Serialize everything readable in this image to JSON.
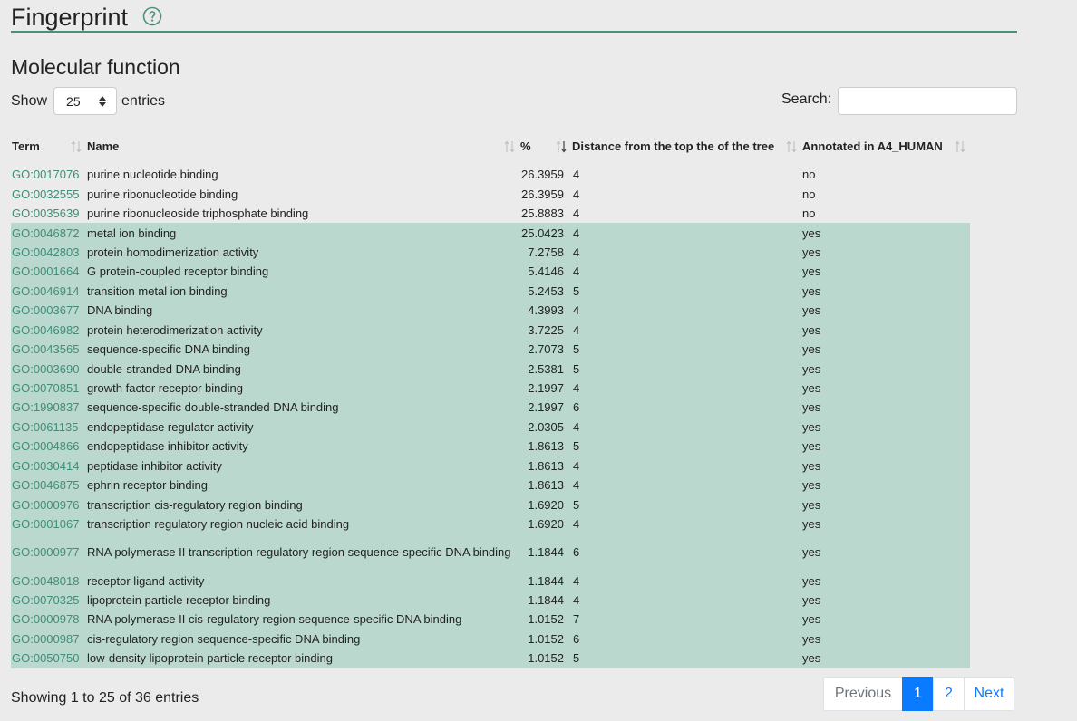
{
  "header": {
    "title": "Fingerprint",
    "help_icon": "question-circle-icon",
    "accent": "#4d8f7c"
  },
  "section": {
    "title": "Molecular function"
  },
  "controls": {
    "show_label": "Show",
    "page_size": "25",
    "entries_label": "entries",
    "search_label": "Search:",
    "search_value": ""
  },
  "table": {
    "columns": [
      "Term",
      "Name",
      "%",
      "Distance from the top the of the tree",
      "Annotated in A4_HUMAN"
    ],
    "highlight_color": "#bbd8cf",
    "link_color": "#3f8e78",
    "rows": [
      {
        "term": "GO:0017076",
        "name": "purine nucleotide binding",
        "pct": "26.3959",
        "dist": "4",
        "annotated": "no"
      },
      {
        "term": "GO:0032555",
        "name": "purine ribonucleotide binding",
        "pct": "26.3959",
        "dist": "4",
        "annotated": "no"
      },
      {
        "term": "GO:0035639",
        "name": "purine ribonucleoside triphosphate binding",
        "pct": "25.8883",
        "dist": "4",
        "annotated": "no"
      },
      {
        "term": "GO:0046872",
        "name": "metal ion binding",
        "pct": "25.0423",
        "dist": "4",
        "annotated": "yes"
      },
      {
        "term": "GO:0042803",
        "name": "protein homodimerization activity",
        "pct": "7.2758",
        "dist": "4",
        "annotated": "yes"
      },
      {
        "term": "GO:0001664",
        "name": "G protein-coupled receptor binding",
        "pct": "5.4146",
        "dist": "4",
        "annotated": "yes"
      },
      {
        "term": "GO:0046914",
        "name": "transition metal ion binding",
        "pct": "5.2453",
        "dist": "5",
        "annotated": "yes"
      },
      {
        "term": "GO:0003677",
        "name": "DNA binding",
        "pct": "4.3993",
        "dist": "4",
        "annotated": "yes"
      },
      {
        "term": "GO:0046982",
        "name": "protein heterodimerization activity",
        "pct": "3.7225",
        "dist": "4",
        "annotated": "yes"
      },
      {
        "term": "GO:0043565",
        "name": "sequence-specific DNA binding",
        "pct": "2.7073",
        "dist": "5",
        "annotated": "yes"
      },
      {
        "term": "GO:0003690",
        "name": "double-stranded DNA binding",
        "pct": "2.5381",
        "dist": "5",
        "annotated": "yes"
      },
      {
        "term": "GO:0070851",
        "name": "growth factor receptor binding",
        "pct": "2.1997",
        "dist": "4",
        "annotated": "yes"
      },
      {
        "term": "GO:1990837",
        "name": "sequence-specific double-stranded DNA binding",
        "pct": "2.1997",
        "dist": "6",
        "annotated": "yes"
      },
      {
        "term": "GO:0061135",
        "name": "endopeptidase regulator activity",
        "pct": "2.0305",
        "dist": "4",
        "annotated": "yes"
      },
      {
        "term": "GO:0004866",
        "name": "endopeptidase inhibitor activity",
        "pct": "1.8613",
        "dist": "5",
        "annotated": "yes"
      },
      {
        "term": "GO:0030414",
        "name": "peptidase inhibitor activity",
        "pct": "1.8613",
        "dist": "4",
        "annotated": "yes"
      },
      {
        "term": "GO:0046875",
        "name": "ephrin receptor binding",
        "pct": "1.8613",
        "dist": "4",
        "annotated": "yes"
      },
      {
        "term": "GO:0000976",
        "name": "transcription cis-regulatory region binding",
        "pct": "1.6920",
        "dist": "5",
        "annotated": "yes"
      },
      {
        "term": "GO:0001067",
        "name": "transcription regulatory region nucleic acid binding",
        "pct": "1.6920",
        "dist": "4",
        "annotated": "yes"
      },
      {
        "term": "GO:0000977",
        "name": "RNA polymerase II transcription regulatory region sequence-specific DNA binding",
        "pct": "1.1844",
        "dist": "6",
        "annotated": "yes"
      },
      {
        "term": "GO:0048018",
        "name": "receptor ligand activity",
        "pct": "1.1844",
        "dist": "4",
        "annotated": "yes"
      },
      {
        "term": "GO:0070325",
        "name": "lipoprotein particle receptor binding",
        "pct": "1.1844",
        "dist": "4",
        "annotated": "yes"
      },
      {
        "term": "GO:0000978",
        "name": "RNA polymerase II cis-regulatory region sequence-specific DNA binding",
        "pct": "1.0152",
        "dist": "7",
        "annotated": "yes"
      },
      {
        "term": "GO:0000987",
        "name": "cis-regulatory region sequence-specific DNA binding",
        "pct": "1.0152",
        "dist": "6",
        "annotated": "yes"
      },
      {
        "term": "GO:0050750",
        "name": "low-density lipoprotein particle receptor binding",
        "pct": "1.0152",
        "dist": "5",
        "annotated": "yes"
      }
    ]
  },
  "footer": {
    "info": "Showing 1 to 25 of 36 entries",
    "pagination": {
      "previous": "Previous",
      "pages": [
        "1",
        "2"
      ],
      "active_page": "1",
      "next": "Next",
      "active_color": "#0a7bff"
    }
  }
}
